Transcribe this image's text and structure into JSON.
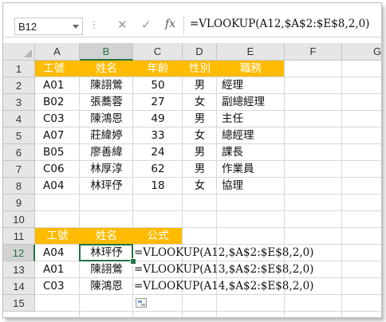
{
  "formula_bar": {
    "name_box": "B12",
    "dots": "⋮",
    "cancel_icon": "✕",
    "enter_icon": "✓",
    "fx_label": "fx",
    "formula": "=VLOOKUP(A12,$A$2:$E$8,2,0)"
  },
  "colors": {
    "header_fill": "#ffbb00",
    "header_text": "#ffffff",
    "selection": "#217346"
  },
  "columns": [
    "A",
    "B",
    "C",
    "D",
    "E",
    "F",
    "G"
  ],
  "rows": [
    "1",
    "2",
    "3",
    "4",
    "5",
    "6",
    "7",
    "8",
    "9",
    "10",
    "11",
    "12",
    "13",
    "14",
    "15"
  ],
  "table1": {
    "headers": [
      "工號",
      "姓名",
      "年齡",
      "性別",
      "職務"
    ],
    "rows": [
      [
        "A01",
        "陳詡鶯",
        "50",
        "男",
        "經理"
      ],
      [
        "B02",
        "張蕎蓉",
        "27",
        "女",
        "副總經理"
      ],
      [
        "C03",
        "陳鴻恩",
        "49",
        "男",
        "主任"
      ],
      [
        "A07",
        "莊緯婷",
        "33",
        "女",
        "總經理"
      ],
      [
        "B05",
        "廖善緯",
        "24",
        "男",
        "課長"
      ],
      [
        "C06",
        "林厚淳",
        "62",
        "男",
        "作業員"
      ],
      [
        "A04",
        "林玶伃",
        "18",
        "女",
        "協理"
      ]
    ]
  },
  "table2": {
    "headers": [
      "工號",
      "姓名",
      "公式"
    ],
    "rows": [
      [
        "A04",
        "林玶伃",
        "=VLOOKUP(A12,$A$2:$E$8,2,0)"
      ],
      [
        "A01",
        "陳詡鶯",
        "=VLOOKUP(A13,$A$2:$E$8,2,0)"
      ],
      [
        "C03",
        "陳鴻恩",
        "=VLOOKUP(A14,$A$2:$E$8,2,0)"
      ]
    ]
  },
  "selected_cell": "B12",
  "paste_options_icon": "paste-options-icon"
}
